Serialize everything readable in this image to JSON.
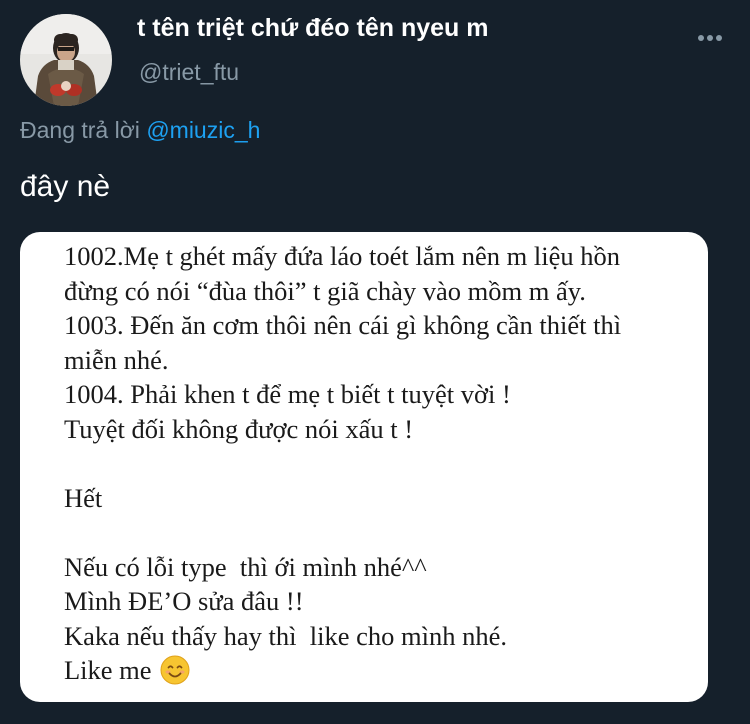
{
  "author": {
    "display_name": "t tên triệt chứ đéo tên nyeu m",
    "handle": "@triet_ftu"
  },
  "reply": {
    "prefix": "Đang trả lời",
    "mention": "@miuzic_h"
  },
  "tweet": {
    "text": "đây nè"
  },
  "media": {
    "lines": [
      "1002.Mẹ t ghét mấy đứa láo toét lắm nên m liệu hồn",
      "đừng có nói “đùa thôi” t giã chày vào mồm m ấy.",
      "1003. Đến ăn cơm thôi nên cái gì không cần thiết thì",
      "miễn nhé.",
      "1004. Phải khen t để mẹ t biết t tuyệt vời !",
      "Tuyệt đối không được nói xấu t !",
      "",
      "Hết",
      "",
      "Nếu có lỗi type  thì ới mình nhé^^",
      "Mình ĐE’O sửa đâu !!",
      "Kaka nếu thấy hay thì  like cho mình nhé.",
      "Like me"
    ],
    "emoji_icon": "smiling-face-emoji"
  },
  "icons": {
    "more": "more-horizontal-icon"
  },
  "colors": {
    "background": "#15202b",
    "secondary_text": "#8899a6",
    "link": "#1da1f2",
    "primary_text": "#ffffff"
  }
}
